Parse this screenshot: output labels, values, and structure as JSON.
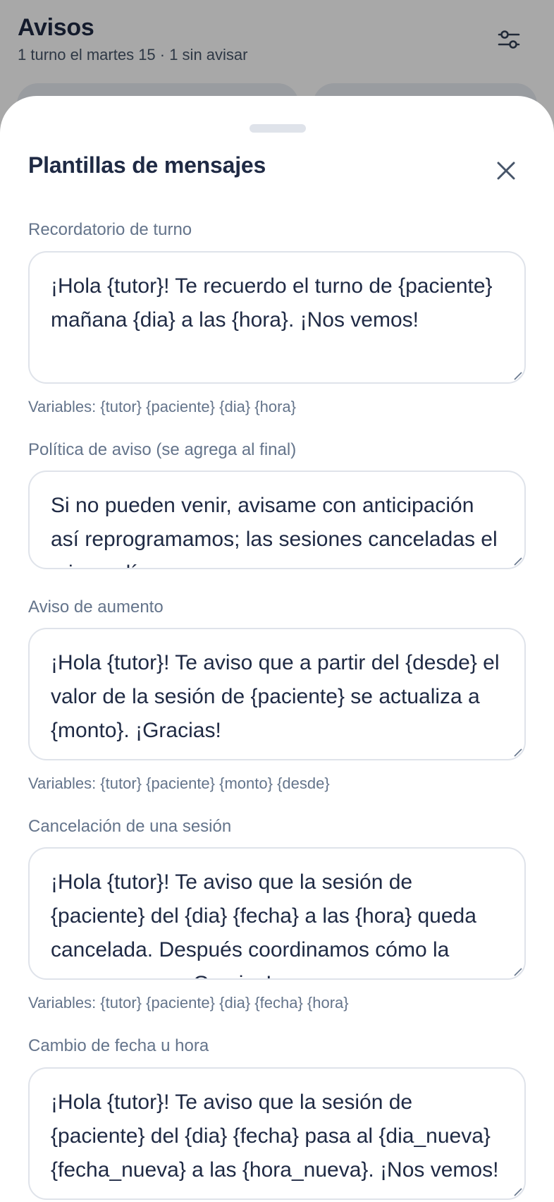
{
  "background": {
    "title": "Avisos",
    "subtitle": "1 turno el martes 15 · 1 sin avisar",
    "filter_icon": "sliders-icon"
  },
  "sheet": {
    "title": "Plantillas de mensajes",
    "close_icon": "close-icon",
    "fields": [
      {
        "label": "Recordatorio de turno",
        "value": "¡Hola {tutor}! Te recuerdo el turno de {paciente} mañana {dia} a las {hora}. ¡Nos vemos!",
        "helper": "Variables: {tutor} {paciente} {dia} {hora}"
      },
      {
        "label": "Política de aviso (se agrega al final)",
        "value": "Si no pueden venir, avisame con anticipación así reprogramamos; las sesiones canceladas el mismo día se"
      },
      {
        "label": "Aviso de aumento",
        "value": "¡Hola {tutor}! Te aviso que a partir del {desde} el valor de la sesión de {paciente} se actualiza a {monto}. ¡Gracias!",
        "helper": "Variables: {tutor} {paciente} {monto} {desde}"
      },
      {
        "label": "Cancelación de una sesión",
        "value": "¡Hola {tutor}! Te aviso que la sesión de {paciente} del {dia} {fecha} a las {hora} queda cancelada. Después coordinamos cómo la recuperamos. ¡Gracias!",
        "helper": "Variables: {tutor} {paciente} {dia} {fecha} {hora}"
      },
      {
        "label": "Cambio de fecha u hora",
        "value": "¡Hola {tutor}! Te aviso que la sesión de {paciente} del {dia} {fecha} pasa al {dia_nueva} {fecha_nueva} a las {hora_nueva}. ¡Nos vemos!"
      }
    ]
  }
}
